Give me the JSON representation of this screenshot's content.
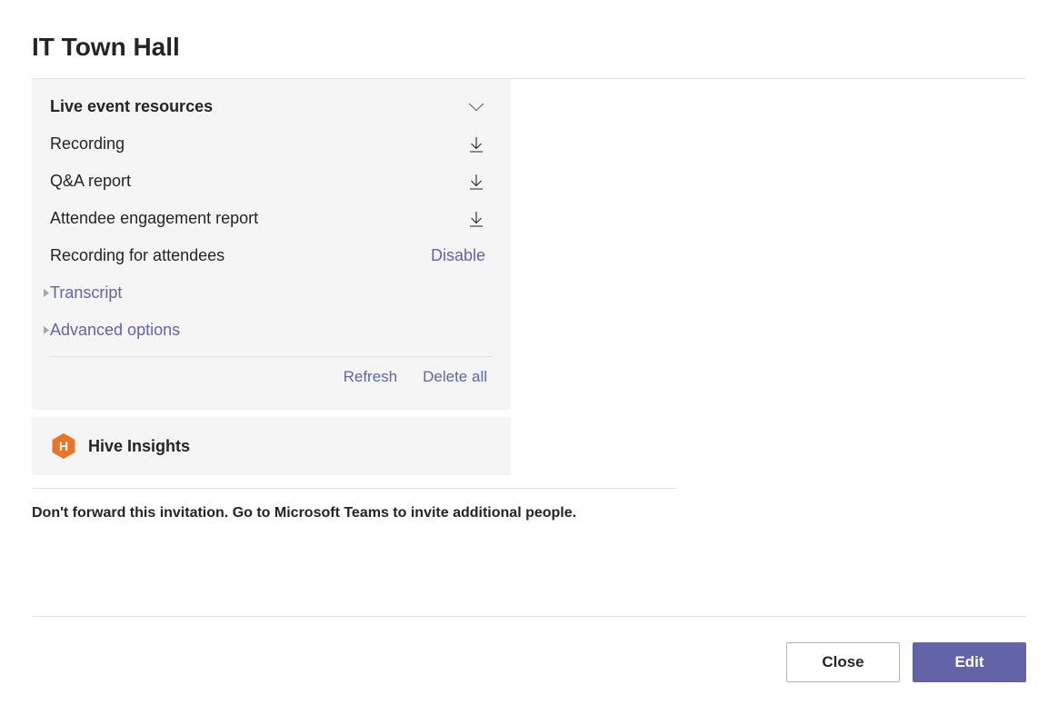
{
  "title": "IT Town Hall",
  "resources": {
    "header": "Live event resources",
    "items": {
      "recording": "Recording",
      "qa_report": "Q&A report",
      "engagement": "Attendee engagement report",
      "rec_attendees": "Recording for attendees",
      "disable": "Disable"
    },
    "expand": {
      "transcript": "Transcript",
      "advanced": "Advanced options"
    },
    "footer": {
      "refresh": "Refresh",
      "delete_all": "Delete all"
    }
  },
  "hive": {
    "title": "Hive Insights",
    "logo_letter": "H"
  },
  "info_text": "Don't forward this invitation. Go to Microsoft Teams to invite additional people.",
  "buttons": {
    "close": "Close",
    "edit": "Edit"
  }
}
